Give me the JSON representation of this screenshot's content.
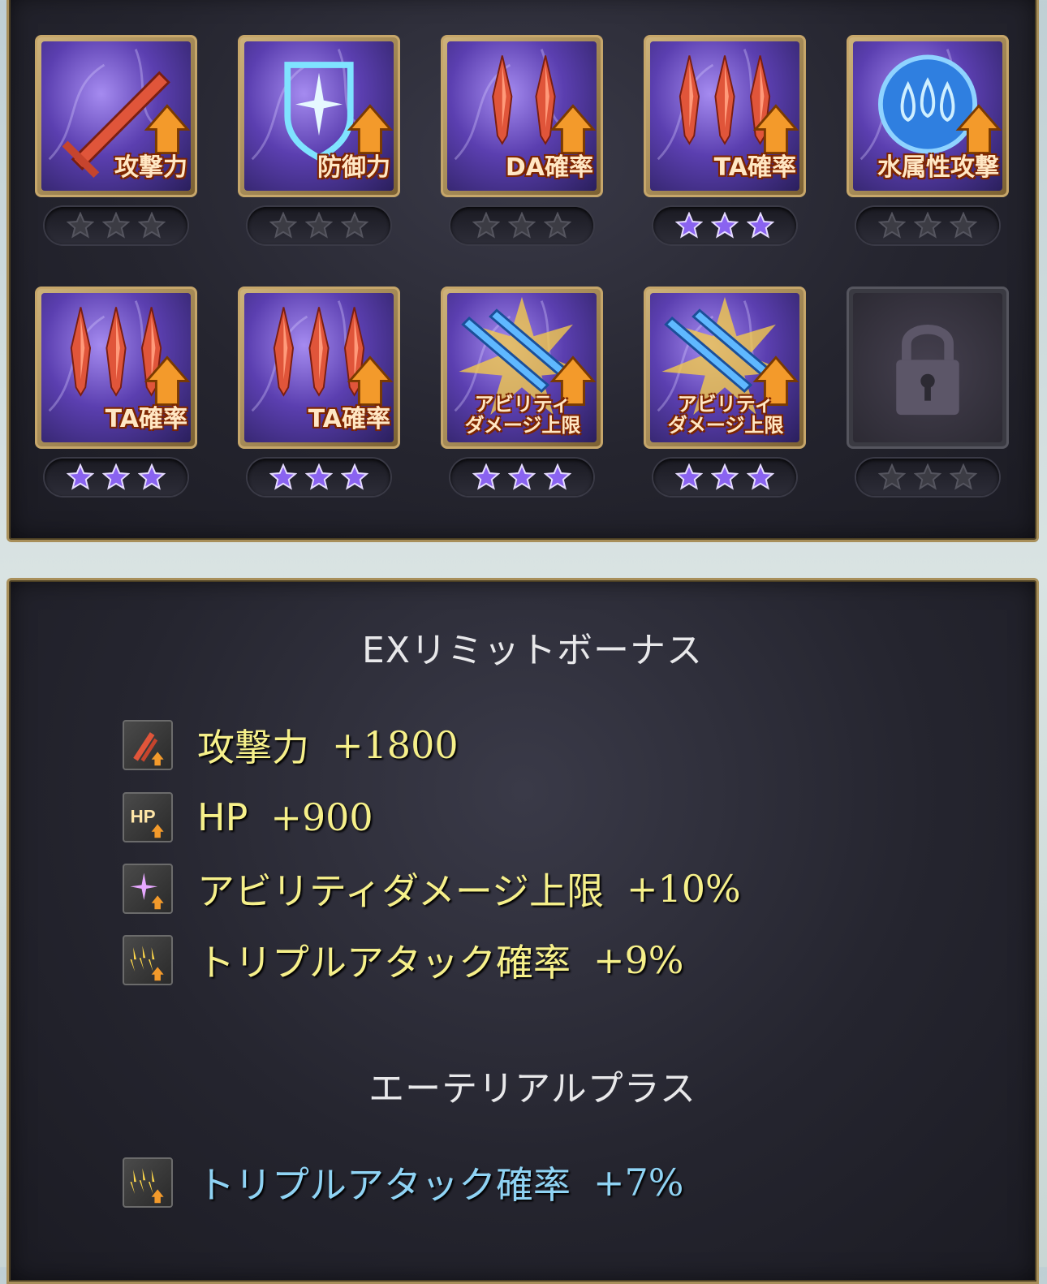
{
  "skills": [
    {
      "label": "攻撃力",
      "type": "sword",
      "stars_filled": 0
    },
    {
      "label": "防御力",
      "type": "shield",
      "stars_filled": 0
    },
    {
      "label": "DA確率",
      "type": "double",
      "stars_filled": 0
    },
    {
      "label": "TA確率",
      "type": "triple",
      "stars_filled": 3
    },
    {
      "label": "水属性攻撃",
      "type": "water",
      "stars_filled": 0
    },
    {
      "label": "TA確率",
      "type": "triple",
      "stars_filled": 3
    },
    {
      "label": "TA確率",
      "type": "triple",
      "stars_filled": 3
    },
    {
      "label": "アビリティ\nダメージ上限",
      "type": "ability",
      "stars_filled": 3
    },
    {
      "label": "アビリティ\nダメージ上限",
      "type": "ability",
      "stars_filled": 3
    },
    {
      "label": "",
      "type": "locked",
      "stars_filled": 0
    }
  ],
  "ex_limit": {
    "title": "EXリミットボーナス",
    "bonuses": [
      {
        "label": "攻撃力",
        "value": "+1800",
        "icon": "attack-up-icon"
      },
      {
        "label": "HP",
        "value": "+900",
        "icon": "hp-up-icon"
      },
      {
        "label": "アビリティダメージ上限",
        "value": "+10%",
        "icon": "ability-damage-cap-icon"
      },
      {
        "label": "トリプルアタック確率",
        "value": "+9%",
        "icon": "triple-attack-icon"
      }
    ]
  },
  "ethereal": {
    "title": "エーテリアルプラス",
    "bonuses": [
      {
        "label": "トリプルアタック確率",
        "value": "+7%",
        "icon": "triple-attack-icon"
      }
    ]
  },
  "colors": {
    "star_filled": "#8a63f0",
    "star_empty": "#3c3c44",
    "bonus_text": "#f6f08a",
    "ethereal_text": "#8fd3f4",
    "frame_gold": "#c6a66a"
  }
}
